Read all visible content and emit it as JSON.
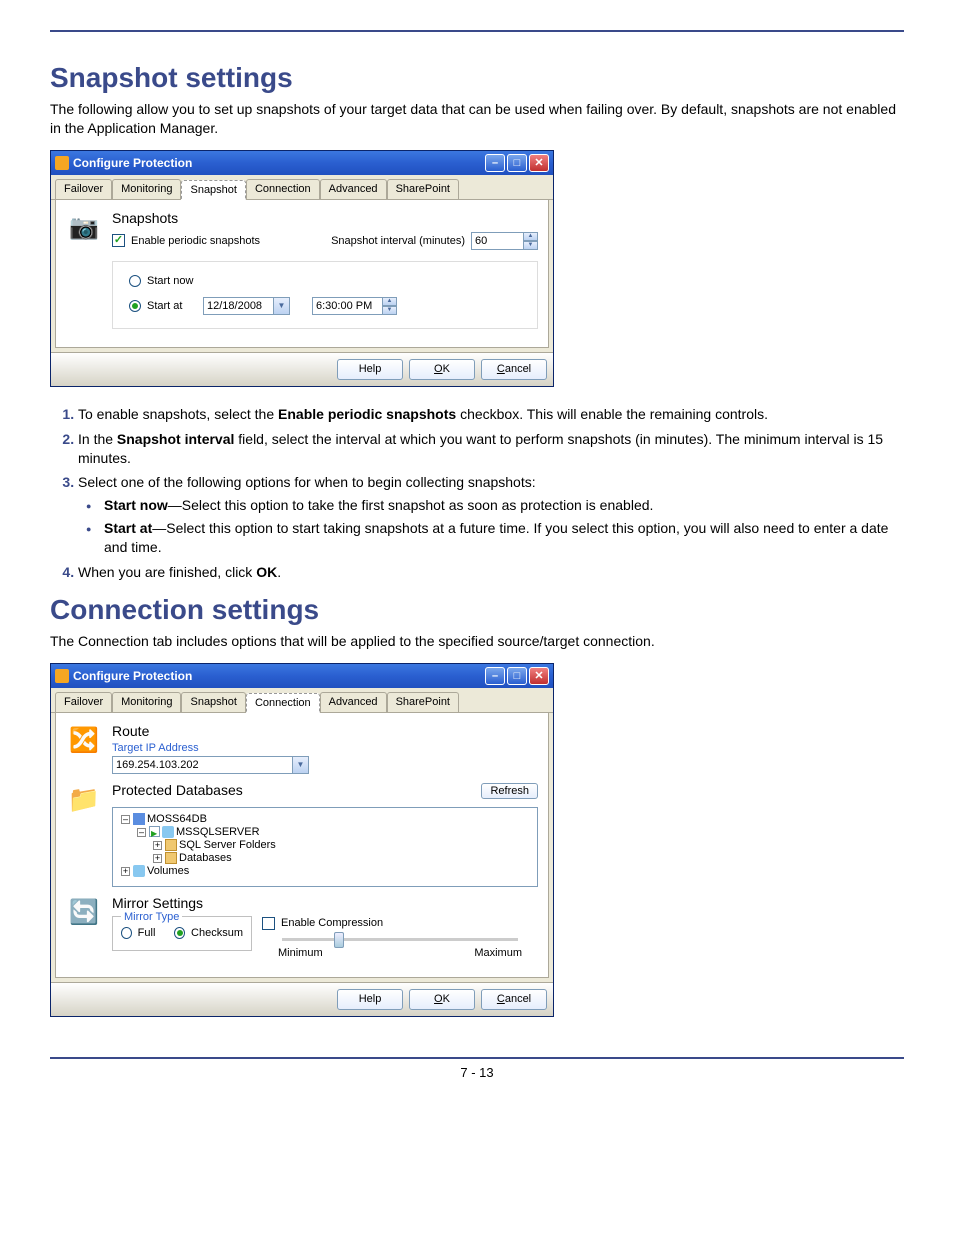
{
  "headings": {
    "snapshot": "Snapshot settings",
    "connection": "Connection settings"
  },
  "intro": {
    "snapshot": "The following allow you to set up snapshots of your target data that can be used when failing over. By default, snapshots are not enabled in the Application Manager.",
    "connection": "The Connection tab includes options that will be applied to the specified source/target connection."
  },
  "dialog": {
    "title": "Configure Protection",
    "tabs": [
      "Failover",
      "Monitoring",
      "Snapshot",
      "Connection",
      "Advanced",
      "SharePoint"
    ],
    "active_tab_snapshot": 2,
    "active_tab_connection": 3,
    "buttons": {
      "help": "Help",
      "ok": "OK",
      "cancel": "Cancel"
    }
  },
  "snapshot_panel": {
    "heading": "Snapshots",
    "enable_label": "Enable periodic snapshots",
    "interval_label": "Snapshot interval (minutes)",
    "interval_value": "60",
    "start_now": "Start now",
    "start_at": "Start at",
    "date": "12/18/2008",
    "time": "6:30:00 PM"
  },
  "connection_panel": {
    "route_heading": "Route",
    "target_ip_label": "Target IP Address",
    "target_ip_value": "169.254.103.202",
    "db_heading": "Protected Databases",
    "refresh": "Refresh",
    "tree": {
      "root": "MOSS64DB",
      "instance": "MSSQLSERVER",
      "folders": "SQL Server Folders",
      "databases": "Databases",
      "volumes": "Volumes"
    },
    "mirror_heading": "Mirror Settings",
    "mirror_type_label": "Mirror Type",
    "full": "Full",
    "checksum": "Checksum",
    "compression": "Enable Compression",
    "slider_min": "Minimum",
    "slider_max": "Maximum"
  },
  "steps": {
    "s1a": "To enable snapshots, select the ",
    "s1b": "Enable periodic snapshots",
    "s1c": " checkbox. This will enable the remaining controls.",
    "s2a": "In the ",
    "s2b": "Snapshot interval",
    "s2c": " field, select the interval at which you want to perform snapshots (in minutes). The minimum interval is 15 minutes.",
    "s3": "Select one of the following options for when to begin collecting snapshots:",
    "b1a": "Start now",
    "b1b": "—Select this option to take the first snapshot as soon as protection is enabled.",
    "b2a": "Start at",
    "b2b": "—Select this option to start taking snapshots at a future time. If you select this option, you will also need to enter a date and time.",
    "s4a": "When you are finished, click ",
    "s4b": "OK",
    "s4c": "."
  },
  "page_number": "7 - 13"
}
